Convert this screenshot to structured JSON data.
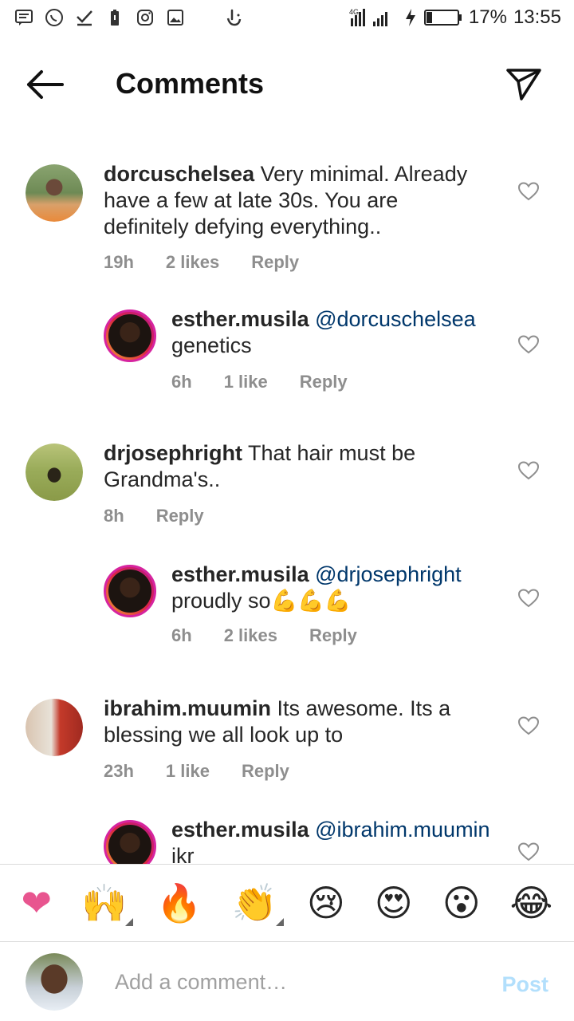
{
  "status": {
    "network": "4G",
    "battery": "17%",
    "time": "13:55"
  },
  "header": {
    "title": "Comments"
  },
  "comments": [
    {
      "username": "dorcuschelsea",
      "text": "Very minimal. Already have a few at late 30s. You are definitely defying everything..",
      "time": "19h",
      "likes": "2 likes",
      "reply": "Reply"
    },
    {
      "username": "esther.musila",
      "mention": "@dorcuschelsea",
      "text": "genetics",
      "time": "6h",
      "likes": "1 like",
      "reply": "Reply"
    },
    {
      "username": "drjosephright",
      "text": "That hair must be Grandma's..",
      "time": "8h",
      "reply": "Reply"
    },
    {
      "username": "esther.musila",
      "mention": "@drjosephright",
      "text": "proudly so💪💪💪",
      "time": "6h",
      "likes": "2 likes",
      "reply": "Reply"
    },
    {
      "username": "ibrahim.muumin",
      "text": "Its awesome. Its a blessing we all look up to",
      "time": "23h",
      "likes": "1 like",
      "reply": "Reply"
    },
    {
      "username": "esther.musila",
      "mention": "@ibrahim.muumin",
      "text": "ikr"
    }
  ],
  "emoji_bar": [
    "❤",
    "🙌",
    "🔥",
    "👏",
    "😢",
    "😍",
    "😮",
    "😂"
  ],
  "composer": {
    "placeholder": "Add a comment…",
    "post_label": "Post"
  },
  "colors": {
    "mention": "#00376b",
    "meta": "#8e8e8e",
    "post_disabled": "#b2dffc",
    "heart_emoji": "#e8558f"
  }
}
